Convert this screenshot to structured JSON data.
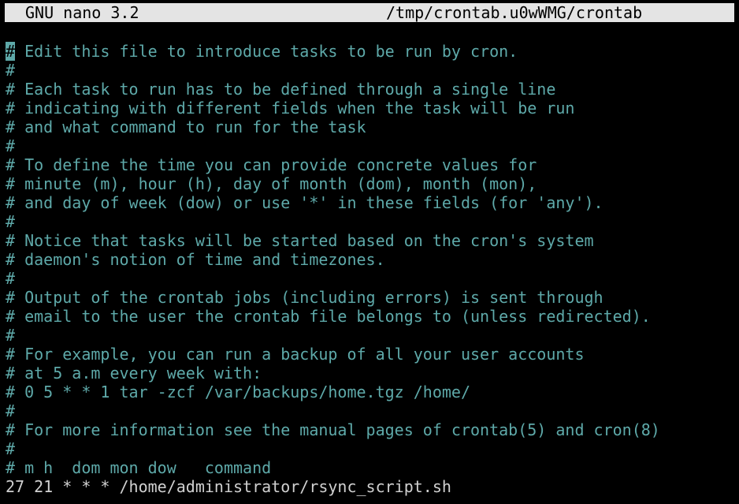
{
  "header": {
    "app_name": "GNU nano 3.2",
    "file_path": "/tmp/crontab.u0wWMG/crontab"
  },
  "colors": {
    "comment": "#5ea9a9",
    "text": "#d0d0d0",
    "header_bg": "#e4e4e4",
    "background": "#000000"
  },
  "editor": {
    "cursor_char": "#",
    "lines": [
      " Edit this file to introduce tasks to be run by cron.",
      "#",
      "# Each task to run has to be defined through a single line",
      "# indicating with different fields when the task will be run",
      "# and what command to run for the task",
      "#",
      "# To define the time you can provide concrete values for",
      "# minute (m), hour (h), day of month (dom), month (mon),",
      "# and day of week (dow) or use '*' in these fields (for 'any').",
      "#",
      "# Notice that tasks will be started based on the cron's system",
      "# daemon's notion of time and timezones.",
      "#",
      "# Output of the crontab jobs (including errors) is sent through",
      "# email to the user the crontab file belongs to (unless redirected).",
      "#",
      "# For example, you can run a backup of all your user accounts",
      "# at 5 a.m every week with:",
      "# 0 5 * * 1 tar -zcf /var/backups/home.tgz /home/",
      "#",
      "# For more information see the manual pages of crontab(5) and cron(8)",
      "#",
      "# m h  dom mon dow   command"
    ],
    "entry_line": "27 21 * * * /home/administrator/rsync_script.sh"
  }
}
